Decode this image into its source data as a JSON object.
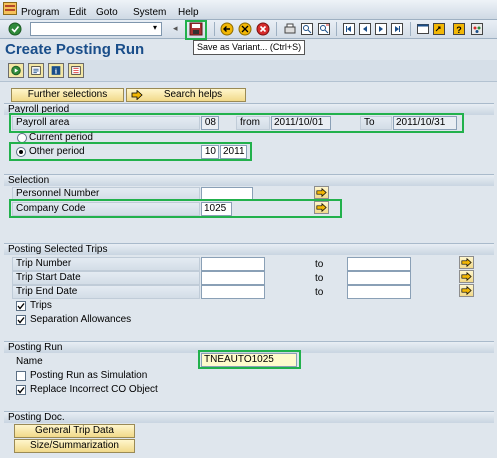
{
  "menu": [
    "Program",
    "Edit",
    "Goto",
    "System",
    "Help"
  ],
  "toolbar": {
    "command_field_value": "",
    "tooltip": "Save as Variant...   (Ctrl+S)",
    "icons": [
      "enter-icon",
      "save-icon",
      "back-icon",
      "exit-icon",
      "cancel-icon",
      "print-icon",
      "find-icon",
      "find-next-icon",
      "first-page-icon",
      "prev-page-icon",
      "next-page-icon",
      "last-page-icon",
      "new-session-icon",
      "shortcut-icon",
      "help-icon",
      "layout-icon"
    ]
  },
  "title": "Create Posting Run",
  "app_toolbar": {
    "icons": [
      "execute-icon",
      "get-variant-icon",
      "program-info-icon",
      "selection-options-icon"
    ]
  },
  "buttons": {
    "further_selections": "Further selections",
    "search_helps": "Search helps"
  },
  "payroll_period": {
    "header": "Payroll period",
    "payroll_area_label": "Payroll area",
    "payroll_area_value": "08",
    "from_label": "from",
    "from_value": "2011/10/01",
    "to_label": "To",
    "to_value": "2011/10/31",
    "current_period_label": "Current period",
    "other_period_label": "Other period",
    "other_period_month": "10",
    "other_period_year": "2011",
    "selected": "other"
  },
  "selection": {
    "header": "Selection",
    "personnel_number_label": "Personnel Number",
    "personnel_number_value": "",
    "company_code_label": "Company Code",
    "company_code_value": "1025"
  },
  "posting_selected_trips": {
    "header": "Posting Selected Trips",
    "rows": [
      {
        "label": "Trip Number",
        "to_label": "to"
      },
      {
        "label": "Trip Start Date",
        "to_label": "to"
      },
      {
        "label": "Trip End Date",
        "to_label": "to"
      }
    ],
    "trips_label": "Trips",
    "trips_checked": true,
    "separation_label": "Separation Allowances",
    "separation_checked": true
  },
  "posting_run": {
    "header": "Posting Run",
    "name_label": "Name",
    "name_value": "TNEAUTO1025",
    "simulation_label": "Posting Run as Simulation",
    "simulation_checked": false,
    "replace_label": "Replace Incorrect CO Object",
    "replace_checked": true
  },
  "posting_doc": {
    "header": "Posting Doc.",
    "general_trip_data": "General Trip Data",
    "size_summarization": "Size/Summarization"
  },
  "colors": {
    "highlight": "#22b14c",
    "title": "#1a4e8a",
    "background": "#dfe6ed"
  }
}
